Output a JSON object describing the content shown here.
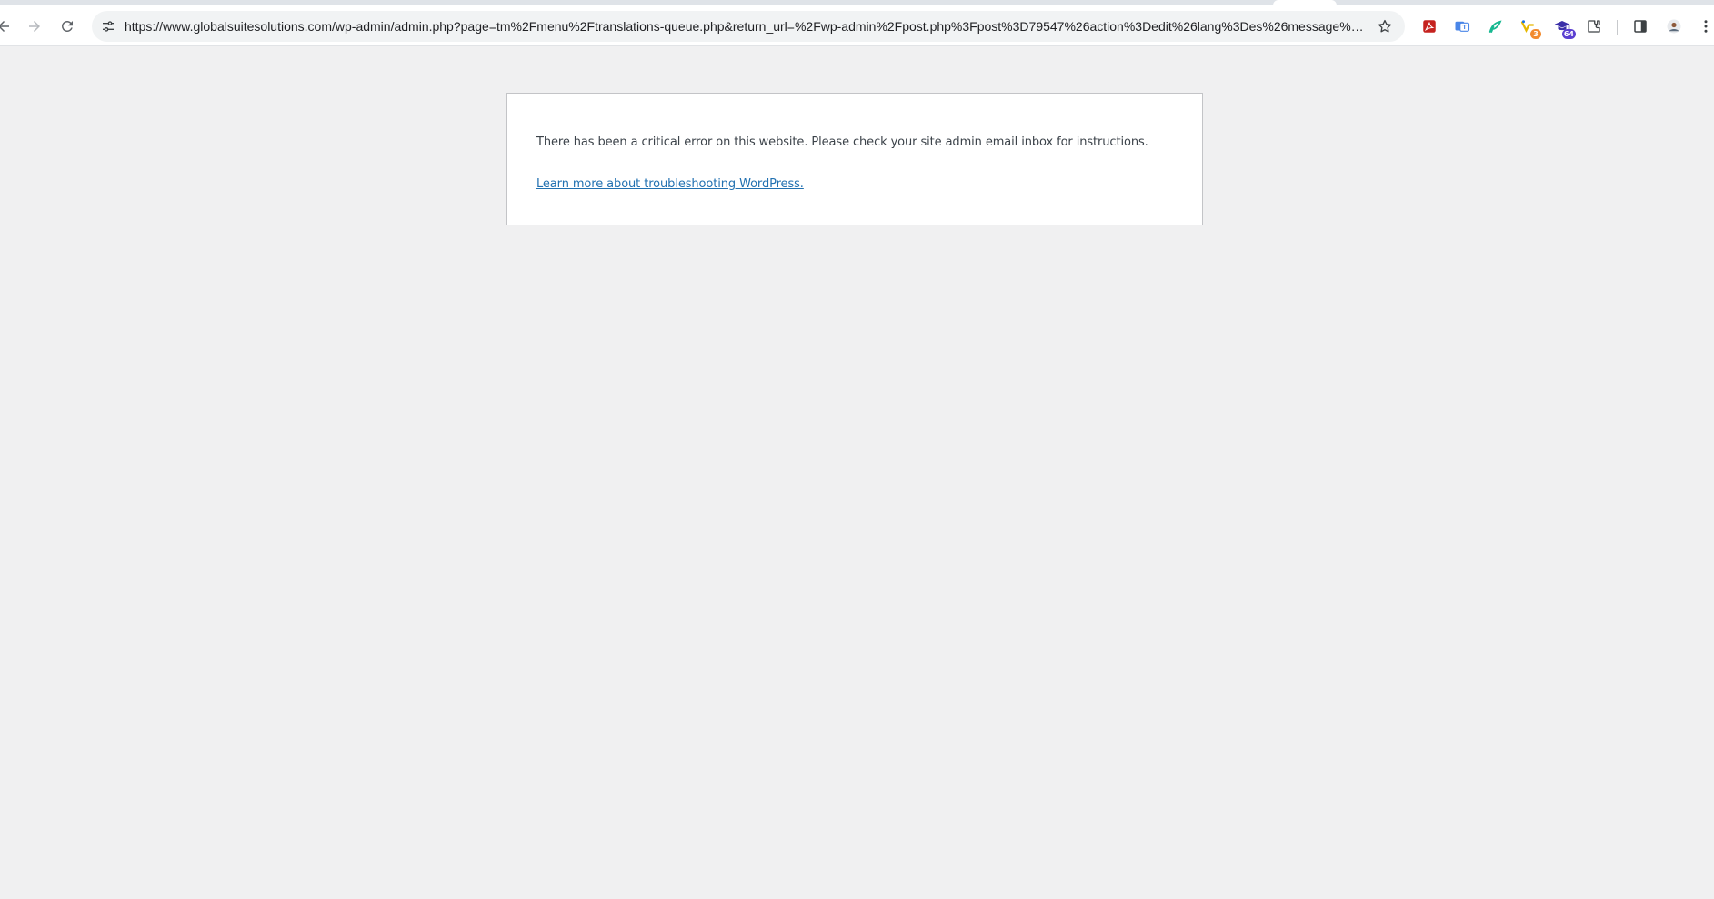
{
  "browser": {
    "url": "https://www.globalsuitesolutions.com/wp-admin/admin.php?page=tm%2Fmenu%2Ftranslations-queue.php&return_url=%2Fwp-admin%2Fpost.php%3Fpost%3D79547%26action%3Dedit%26lang%3Des%26message%3D...",
    "nav_icons": [
      "back-arrow-icon",
      "forward-arrow-icon",
      "reload-icon"
    ],
    "site_info_icon": "tune-icon",
    "bookmark_icon": "star-outline-icon",
    "extensions": [
      {
        "icon": "pdf-icon",
        "color": "#c5221f"
      },
      {
        "icon": "translate-icon",
        "color": "#4a86e8"
      },
      {
        "icon": "leaf-icon",
        "color": "#17b890"
      },
      {
        "icon": "grammar-icon",
        "color": "#e6b800",
        "badge": "3",
        "badge_color": "#f28b30"
      },
      {
        "icon": "graduation-cap-icon",
        "color": "#3b2fa8",
        "badge": "64",
        "badge_color": "#5b3fd1"
      },
      {
        "icon": "puzzle-icon",
        "color": "#3c4043"
      }
    ],
    "side_panel_icon": "side-panel-icon",
    "profile_icon": "avatar-icon",
    "menu_icon": "kebab-menu-icon"
  },
  "error": {
    "message": "There has been a critical error on this website. Please check your site admin email inbox for instructions.",
    "link_text": "Learn more about troubleshooting WordPress.",
    "link_color": "#2271b1"
  }
}
